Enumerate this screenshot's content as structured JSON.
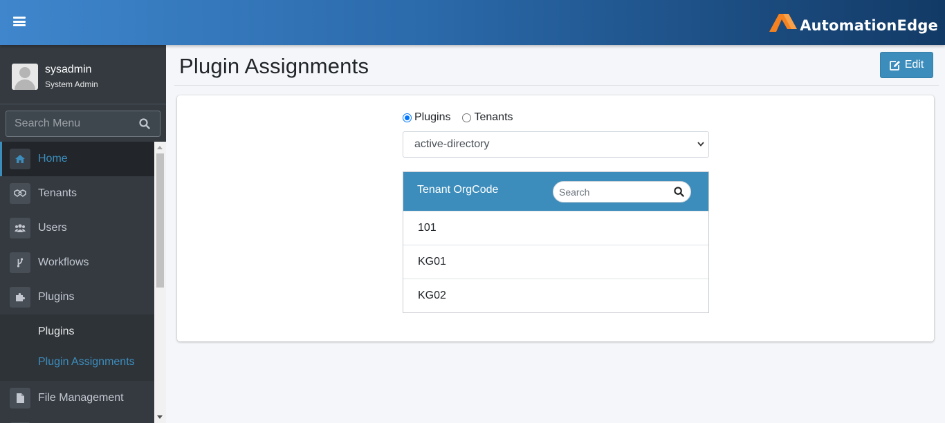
{
  "header": {
    "brand_text": "AutomationEdge",
    "brand_color": "#f58220"
  },
  "sidebar": {
    "user": {
      "name": "sysadmin",
      "role": "System Admin"
    },
    "search_placeholder": "Search Menu",
    "items": [
      {
        "label": "Home",
        "icon": "home-icon",
        "active": true
      },
      {
        "label": "Tenants",
        "icon": "handshake-icon"
      },
      {
        "label": "Users",
        "icon": "users-icon"
      },
      {
        "label": "Workflows",
        "icon": "branch-icon"
      },
      {
        "label": "Plugins",
        "icon": "puzzle-icon"
      }
    ],
    "sub_items": [
      {
        "label": "Plugins"
      },
      {
        "label": "Plugin Assignments",
        "current": true
      }
    ],
    "after_items": [
      {
        "label": "File Management",
        "icon": "file-icon"
      }
    ],
    "accent_color": "#3c8dbc"
  },
  "main": {
    "title": "Plugin Assignments",
    "edit_label": "Edit",
    "radios": [
      {
        "label": "Plugins",
        "checked": true
      },
      {
        "label": "Tenants",
        "checked": false
      }
    ],
    "selected_plugin": "active-directory",
    "table": {
      "column_title": "Tenant OrgCode",
      "search_placeholder": "Search",
      "rows": [
        "101",
        "KG01",
        "KG02"
      ]
    }
  }
}
